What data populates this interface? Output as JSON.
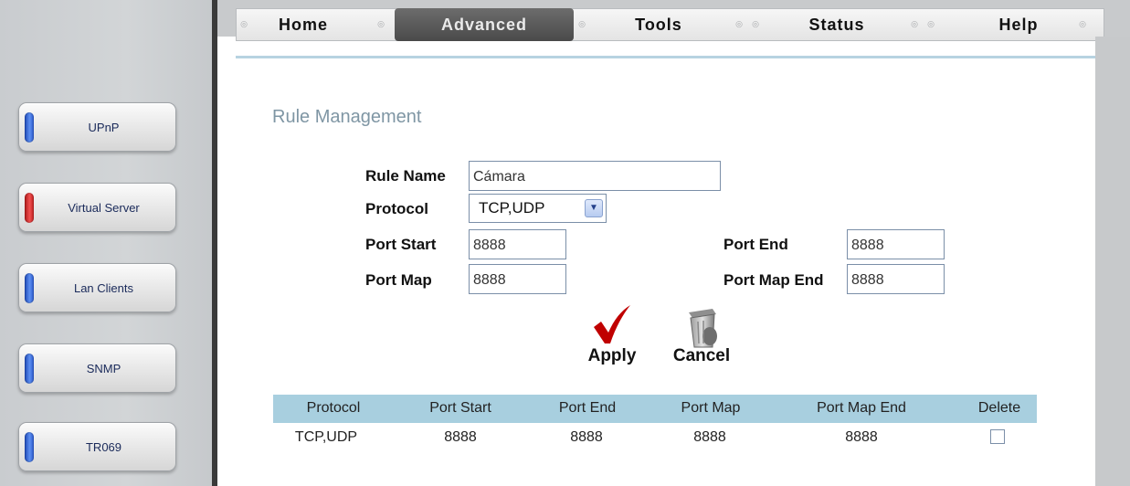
{
  "nav": {
    "tabs": [
      {
        "label": "Home",
        "active": false
      },
      {
        "label": "Advanced",
        "active": true
      },
      {
        "label": "Tools",
        "active": false
      },
      {
        "label": "Status",
        "active": false
      },
      {
        "label": "Help",
        "active": false
      }
    ]
  },
  "sidebar": {
    "items": [
      {
        "label": "UPnP",
        "indicator": "blue"
      },
      {
        "label": "Virtual Server",
        "indicator": "red"
      },
      {
        "label": "Lan Clients",
        "indicator": "blue"
      },
      {
        "label": "SNMP",
        "indicator": "blue"
      },
      {
        "label": "TR069",
        "indicator": "blue"
      }
    ]
  },
  "form": {
    "title": "Rule Management",
    "rule_name_label": "Rule Name",
    "rule_name_value": "Cámara",
    "protocol_label": "Protocol",
    "protocol_value": "TCP,UDP",
    "port_start_label": "Port Start",
    "port_start_value": "8888",
    "port_end_label": "Port End",
    "port_end_value": "8888",
    "port_map_label": "Port Map",
    "port_map_value": "8888",
    "port_map_end_label": "Port Map End",
    "port_map_end_value": "8888",
    "apply_label": "Apply",
    "cancel_label": "Cancel"
  },
  "table": {
    "columns": [
      "Protocol",
      "Port Start",
      "Port End",
      "Port Map",
      "Port Map End",
      "Delete"
    ],
    "rows": [
      {
        "protocol": "TCP,UDP",
        "port_start": "8888",
        "port_end": "8888",
        "port_map": "8888",
        "port_map_end": "8888",
        "delete_checked": false
      }
    ]
  },
  "colors": {
    "active_tab": "#4a4a4a",
    "heading": "#7f96a4",
    "table_header": "#a8cfdf",
    "apply_check": "#c00000",
    "indicator_blue": "#3a6fe0",
    "indicator_red": "#e03030"
  },
  "icons": {
    "apply": "checkmark-icon",
    "cancel": "trash-can-icon"
  }
}
